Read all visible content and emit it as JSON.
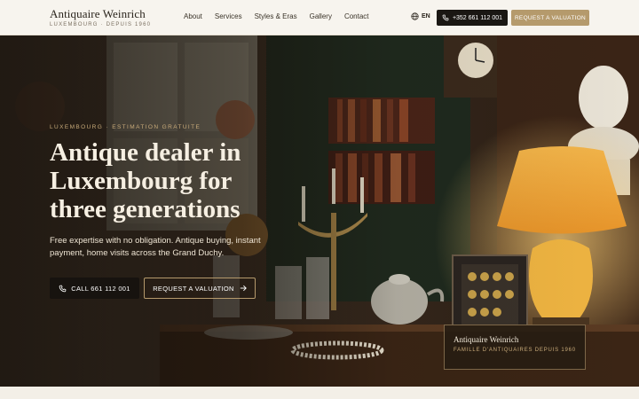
{
  "header": {
    "brand_name": "Antiquaire Weinrich",
    "brand_tagline": "LUXEMBOURG · DEPUIS 1960",
    "nav": [
      "About",
      "Services",
      "Styles & Eras",
      "Gallery",
      "Contact"
    ],
    "language": "EN",
    "phone_label": "+352 661 112 001",
    "valuation_label": "REQUEST A VALUATION"
  },
  "hero": {
    "eyebrow": "LUXEMBOURG · ESTIMATION GRATUITE",
    "headline": "Antique dealer in Luxembourg for three generations",
    "subtext": "Free expertise with no obligation. Antique buying, instant payment, home visits across the Grand Duchy.",
    "call_button": "CALL 661 112 001",
    "valuation_button": "REQUEST A VALUATION"
  },
  "badge": {
    "title": "Antiquaire Weinrich",
    "subtitle": "FAMILLE D'ANTIQUAIRES DEPUIS 1960"
  },
  "colors": {
    "accent_gold": "#b59a6c",
    "dark": "#1a1713",
    "cream": "#f7f4ee"
  },
  "icons": [
    "globe-icon",
    "phone-icon",
    "arrow-right-icon"
  ]
}
